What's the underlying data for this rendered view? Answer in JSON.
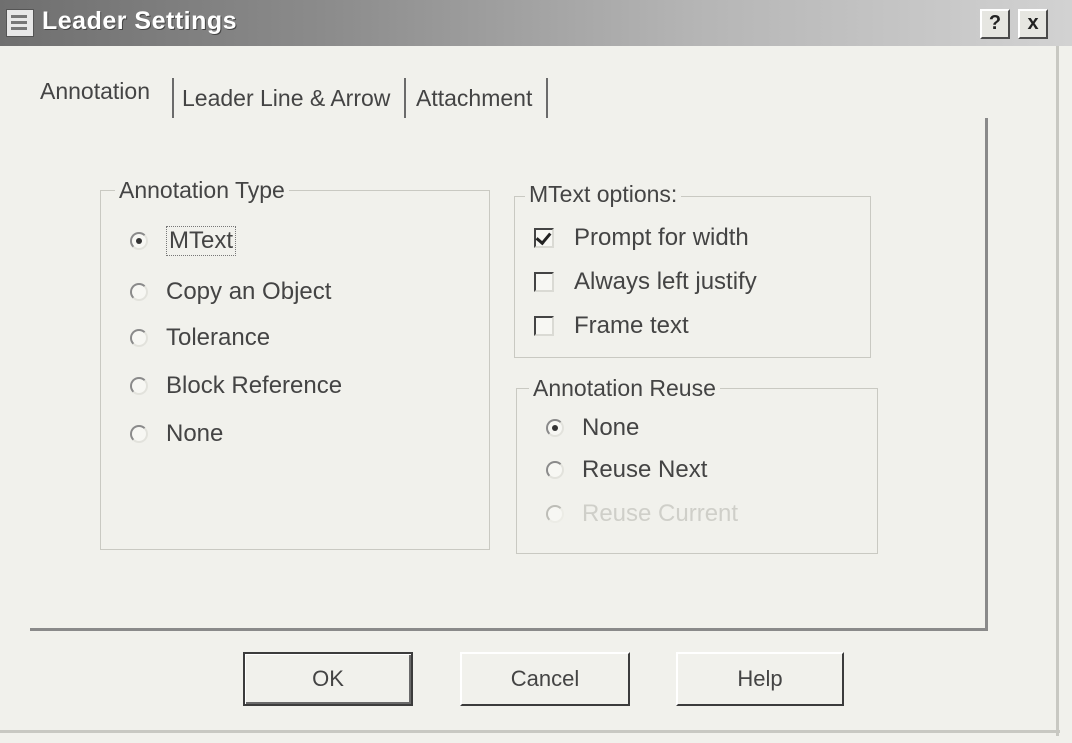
{
  "window": {
    "title": "Leader Settings",
    "help_button": "?",
    "close_button": "x"
  },
  "tabs": [
    {
      "label": "Annotation",
      "active": true
    },
    {
      "label": "Leader Line & Arrow",
      "active": false
    },
    {
      "label": "Attachment",
      "active": false
    }
  ],
  "annotation_type": {
    "legend": "Annotation Type",
    "options": [
      {
        "label": "MText",
        "selected": true
      },
      {
        "label": "Copy an Object",
        "selected": false
      },
      {
        "label": "Tolerance",
        "selected": false
      },
      {
        "label": "Block Reference",
        "selected": false
      },
      {
        "label": "None",
        "selected": false
      }
    ]
  },
  "mtext_options": {
    "legend": "MText options:",
    "options": [
      {
        "label": "Prompt for width",
        "checked": true
      },
      {
        "label": "Always left justify",
        "checked": false
      },
      {
        "label": "Frame text",
        "checked": false
      }
    ]
  },
  "annotation_reuse": {
    "legend": "Annotation Reuse",
    "options": [
      {
        "label": "None",
        "selected": true,
        "enabled": true
      },
      {
        "label": "Reuse Next",
        "selected": false,
        "enabled": true
      },
      {
        "label": "Reuse Current",
        "selected": false,
        "enabled": false
      }
    ]
  },
  "buttons": {
    "ok": "OK",
    "cancel": "Cancel",
    "help": "Help"
  }
}
